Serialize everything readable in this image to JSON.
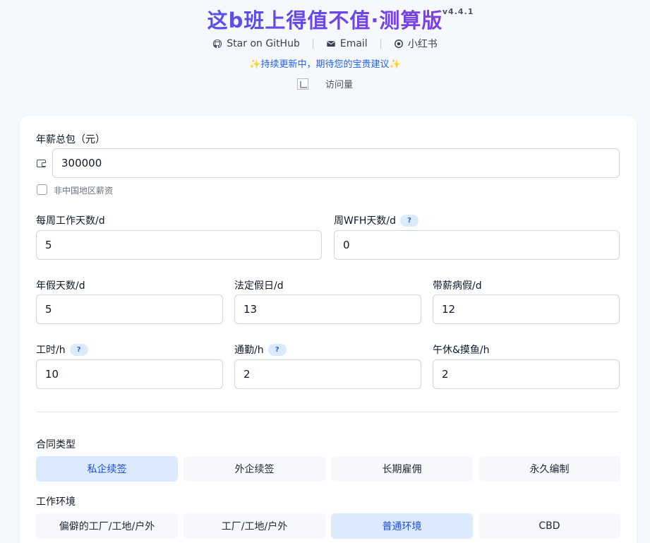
{
  "header": {
    "title": "这b班上得值不值·测算版",
    "version": "v4.4.1",
    "links": [
      {
        "icon": "github-icon",
        "label": "Star on GitHub"
      },
      {
        "icon": "mail-icon",
        "label": "Email"
      },
      {
        "icon": "xiaohongshu-icon",
        "label": "小红书"
      }
    ],
    "notice_spark": "✨",
    "notice": "持续更新中，期待您的宝贵建议",
    "visits_label": "访问量"
  },
  "form": {
    "salary": {
      "label": "年薪总包（元）",
      "value": "300000"
    },
    "non_china": {
      "label": "非中国地区薪资",
      "checked": false
    },
    "work_days": {
      "label": "每周工作天数/d",
      "value": "5"
    },
    "wfh_days": {
      "label": "周WFH天数/d",
      "value": "0",
      "help": "?"
    },
    "annual_leave": {
      "label": "年假天数/d",
      "value": "5"
    },
    "holidays": {
      "label": "法定假日/d",
      "value": "13"
    },
    "sick_leave": {
      "label": "带薪病假/d",
      "value": "12"
    },
    "work_hours": {
      "label": "工时/h",
      "value": "10",
      "help": "?"
    },
    "commute": {
      "label": "通勤/h",
      "value": "2",
      "help": "?"
    },
    "rest": {
      "label": "午休&摸鱼/h",
      "value": "2"
    }
  },
  "contract": {
    "label": "合同类型",
    "options": [
      "私企续签",
      "外企续签",
      "长期雇佣",
      "永久编制"
    ],
    "selected": 0
  },
  "environment": {
    "label": "工作环境",
    "options": [
      "偏僻的工厂/工地/户外",
      "工厂/工地/户外",
      "普通环境",
      "CBD"
    ],
    "selected": 2
  },
  "colors": {
    "title_gradient": [
      "#5b4fe6",
      "#7b3fe4"
    ],
    "accent": "#2563eb",
    "selected_bg": "#dbeafe",
    "page_bg": "#f5f8fc"
  }
}
